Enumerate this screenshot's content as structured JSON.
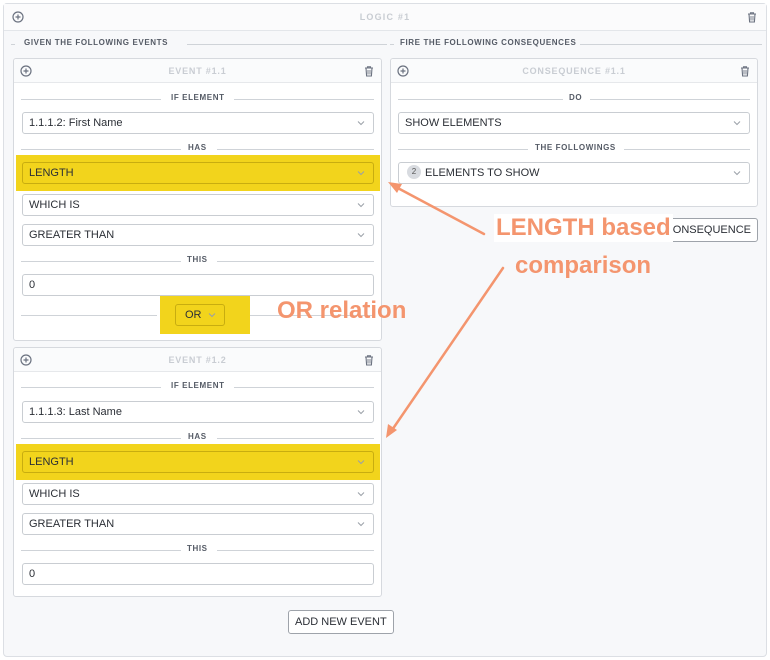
{
  "logic": {
    "title": "LOGIC #1"
  },
  "events_section": {
    "label": "GIVEN THE FOLLOWING EVENTS"
  },
  "consequences_section": {
    "label": "FIRE THE FOLLOWING CONSEQUENCES"
  },
  "events": [
    {
      "title": "EVENT #1.1",
      "if_element_label": "IF ELEMENT",
      "element": "1.1.1.2: First Name",
      "has_label": "HAS",
      "property": "LENGTH",
      "which_is": "WHICH IS",
      "operator": "GREATER THAN",
      "this_label": "THIS",
      "value": "0",
      "relation": "OR"
    },
    {
      "title": "EVENT #1.2",
      "if_element_label": "IF ELEMENT",
      "element": "1.1.1.3: Last Name",
      "has_label": "HAS",
      "property": "LENGTH",
      "which_is": "WHICH IS",
      "operator": "GREATER THAN",
      "this_label": "THIS",
      "value": "0"
    }
  ],
  "consequence": {
    "title": "CONSEQUENCE #1.1",
    "do_label": "DO",
    "action": "SHOW ELEMENTS",
    "followings_label": "THE FOLLOWINGS",
    "count": "2",
    "target": "ELEMENTS TO SHOW",
    "add_button_visible_text": "CONSEQUENCE"
  },
  "add_event_button": "ADD NEW EVENT",
  "annotations": {
    "length_line1": "LENGTH based",
    "length_line2": "comparison",
    "or_note": "OR relation"
  },
  "colors": {
    "highlight": "#f2d41c",
    "annotation": "#f4956e"
  }
}
